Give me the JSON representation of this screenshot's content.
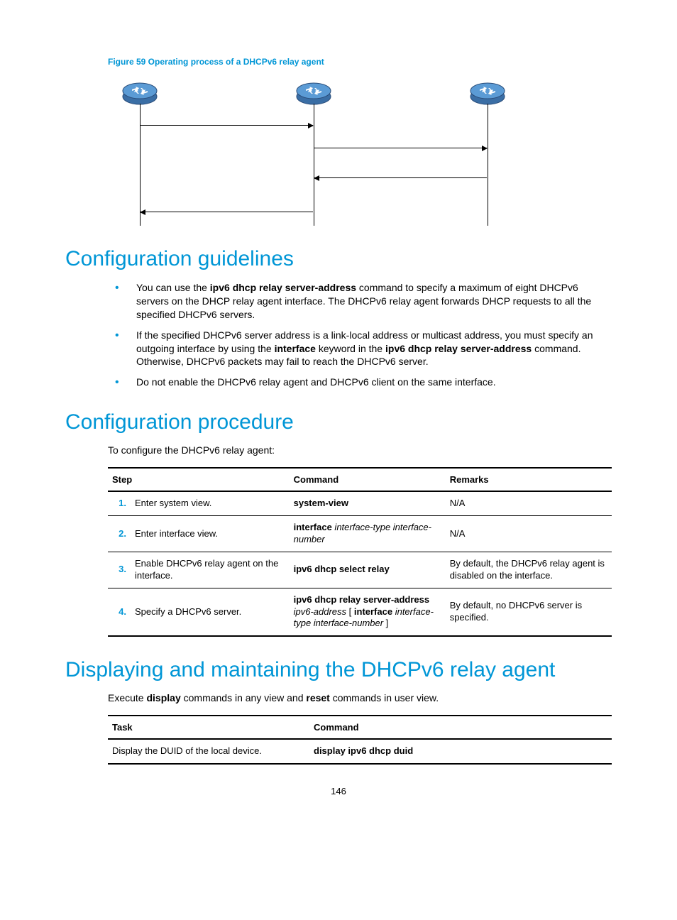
{
  "figure_caption": "Figure 59 Operating process of a DHCPv6 relay agent",
  "h1_guidelines": "Configuration guidelines",
  "guidelines": [
    {
      "before": "You can use the ",
      "bold1": "ipv6 dhcp relay server-address",
      "after": " command to specify a maximum of eight DHCPv6 servers on the DHCP relay agent interface. The DHCPv6 relay agent forwards DHCP requests to all the specified DHCPv6 servers."
    },
    {
      "before": "If the specified DHCPv6 server address is a link-local address or multicast address, you must specify an outgoing interface by using the ",
      "bold1": "interface",
      "mid": " keyword in the ",
      "bold2": "ipv6 dhcp relay server-address",
      "after": " command. Otherwise, DHCPv6 packets may fail to reach the DHCPv6 server."
    },
    {
      "before": "Do not enable the DHCPv6 relay agent and DHCPv6 client on the same interface.",
      "bold1": "",
      "after": ""
    }
  ],
  "h1_procedure": "Configuration procedure",
  "proc_intro": "To configure the DHCPv6 relay agent:",
  "proc_headers": {
    "step": "Step",
    "command": "Command",
    "remarks": "Remarks"
  },
  "proc_rows": [
    {
      "num": "1.",
      "step": "Enter system view.",
      "cmd_bold": "system-view",
      "cmd_italic": "",
      "remarks": "N/A"
    },
    {
      "num": "2.",
      "step": "Enter interface view.",
      "cmd_bold": "interface",
      "cmd_italic": " interface-type interface-number",
      "remarks": "N/A"
    },
    {
      "num": "3.",
      "step": "Enable DHCPv6 relay agent on the interface.",
      "cmd_bold": "ipv6 dhcp select relay",
      "cmd_italic": "",
      "remarks": "By default, the DHCPv6 relay agent is disabled on the interface."
    },
    {
      "num": "4.",
      "step": "Specify a DHCPv6 server.",
      "cmd_bold": "ipv6 dhcp relay server-address",
      "cmd_italic_1": " ipv6-address",
      "cmd_bold_2": " [ interface",
      "cmd_italic_2": " interface-type interface-number",
      "cmd_close": " ]",
      "remarks": "By default, no DHCPv6 server is specified."
    }
  ],
  "h1_display": "Displaying and maintaining the DHCPv6 relay agent",
  "display_intro_before": "Execute ",
  "display_intro_b1": "display",
  "display_intro_mid": " commands in any view and ",
  "display_intro_b2": "reset",
  "display_intro_after": " commands in user view.",
  "task_headers": {
    "task": "Task",
    "command": "Command"
  },
  "task_rows": [
    {
      "task": "Display the DUID of the local device.",
      "cmd": "display ipv6 dhcp duid"
    }
  ],
  "page_number": "146"
}
